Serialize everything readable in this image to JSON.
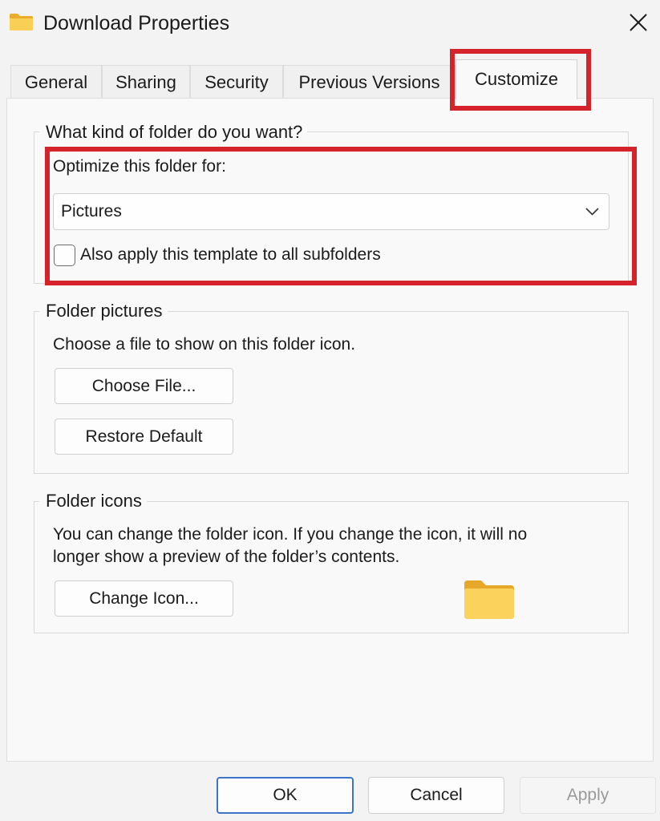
{
  "window": {
    "title": "Download Properties"
  },
  "tabs": [
    {
      "label": "General"
    },
    {
      "label": "Sharing"
    },
    {
      "label": "Security"
    },
    {
      "label": "Previous Versions"
    },
    {
      "label": "Customize",
      "active": true
    }
  ],
  "folder_type": {
    "legend": "What kind of folder do you want?",
    "optimize_label": "Optimize this folder for:",
    "optimize_value": "Pictures",
    "subfolders_label": "Also apply this template to all subfolders",
    "subfolders_checked": false
  },
  "folder_pictures": {
    "legend": "Folder pictures",
    "description": "Choose a file to show on this folder icon.",
    "choose_file_label": "Choose File...",
    "restore_default_label": "Restore Default"
  },
  "folder_icons": {
    "legend": "Folder icons",
    "description_line1": "You can change the folder icon. If you change the icon, it will no",
    "description_line2": "longer show a preview of the folder’s contents.",
    "change_icon_label": "Change Icon...",
    "preview_icon": "folder-icon"
  },
  "footer": {
    "ok_label": "OK",
    "cancel_label": "Cancel",
    "apply_label": "Apply",
    "apply_enabled": false
  },
  "colors": {
    "highlight": "#d5232c",
    "primary_border": "#3b73c5",
    "folder_yellow": "#f7c948"
  }
}
